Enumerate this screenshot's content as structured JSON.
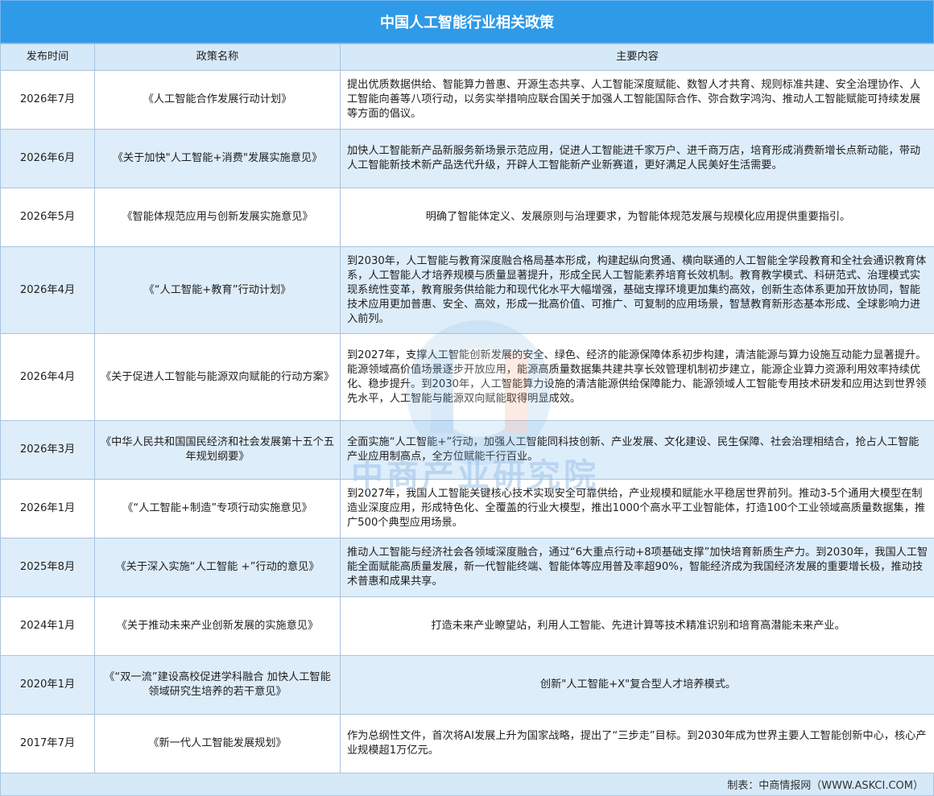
{
  "title": "中国人工智能行业相关政策",
  "headers": [
    "发布时间",
    "政策名称",
    "主要内容"
  ],
  "rows": [
    {
      "date": "2026年7月",
      "name": "《人工智能合作发展行动计划》",
      "content": "提出优质数据供给、智能算力普惠、开源生态共享、人工智能深度赋能、数智人才共育、规则标准共建、安全治理协作、人工智能向善等八项行动，以务实举措响应联合国关于加强人工智能国际合作、弥合数字鸿沟、推动人工智能赋能可持续发展等方面的倡议。"
    },
    {
      "date": "2026年6月",
      "name": "《关于加快\"人工智能+消费\"发展实施意见》",
      "content": "加快人工智能新产品新服务新场景示范应用，促进人工智能进千家万户、进千商万店，培育形成消费新增长点新动能，带动人工智能新技术新产品迭代升级，开辟人工智能新产业新赛道，更好满足人民美好生活需要。"
    },
    {
      "date": "2026年5月",
      "name": "《智能体规范应用与创新发展实施意见》",
      "content": "明确了智能体定义、发展原则与治理要求，为智能体规范发展与规模化应用提供重要指引。"
    },
    {
      "date": "2026年4月",
      "name": "《“人工智能+教育”行动计划》",
      "content": "到2030年，人工智能与教育深度融合格局基本形成，构建起纵向贯通、横向联通的人工智能全学段教育和全社会通识教育体系，人工智能人才培养规模与质量显著提升，形成全民人工智能素养培育长效机制。教育教学模式、科研范式、治理模式实现系统性变革，教育服务供给能力和现代化水平大幅增强，基础支撑环境更加集约高效，创新生态体系更加开放协同，智能技术应用更加普惠、安全、高效，形成一批高价值、可推广、可复制的应用场景，智慧教育新形态基本形成、全球影响力进入前列。"
    },
    {
      "date": "2026年4月",
      "name": "《关于促进人工智能与能源双向赋能的行动方案》",
      "content": "到2027年，支撑人工智能创新发展的安全、绿色、经济的能源保障体系初步构建，清洁能源与算力设施互动能力显著提升。能源领域高价值场景逐步开放应用，能源高质量数据集共建共享长效管理机制初步建立，能源企业算力资源利用效率持续优化、稳步提升。到2030年，人工智能算力设施的清洁能源供给保障能力、能源领域人工智能专用技术研发和应用达到世界领先水平，人工智能与能源双向赋能取得明显成效。"
    },
    {
      "date": "2026年3月",
      "name": "《中华人民共和国国民经济和社会发展第十五个五年规划纲要》",
      "content": "全面实施“人工智能+”行动，加强人工智能同科技创新、产业发展、文化建设、民生保障、社会治理相结合，抢占人工智能产业应用制高点，全方位赋能千行百业。"
    },
    {
      "date": "2026年1月",
      "name": "《“人工智能+制造”专项行动实施意见》",
      "content": "到2027年，我国人工智能关键核心技术实现安全可靠供给，产业规模和赋能水平稳居世界前列。推动3-5个通用大模型在制造业深度应用，形成特色化、全覆盖的行业大模型，推出1000个高水平工业智能体，打造100个工业领域高质量数据集，推广500个典型应用场景。"
    },
    {
      "date": "2025年8月",
      "name": "《关于深入实施“人工智能 +”行动的意见》",
      "content": "推动人工智能与经济社会各领域深度融合，通过“6大重点行动+8项基础支撑”加快培育新质生产力。到2030年，我国人工智能全面赋能高质量发展，新一代智能终端、智能体等应用普及率超90%，智能经济成为我国经济发展的重要增长极，推动技术普惠和成果共享。"
    },
    {
      "date": "2024年1月",
      "name": "《关于推动未来产业创新发展的实施意见》",
      "content": "打造未来产业瞭望站，利用人工智能、先进计算等技术精准识别和培育高潜能未来产业。"
    },
    {
      "date": "2020年1月",
      "name": "《“双一流”建设高校促进学科融合 加快人工智能领域研究生培养的若干意见》",
      "content": "创新\"人工智能+X\"复合型人才培养模式。"
    },
    {
      "date": "2017年7月",
      "name": "《新一代人工智能发展规划》",
      "content": "作为总纲性文件，首次将AI发展上升为国家战略，提出了“三步走”目标。到2030年成为世界主要人工智能创新中心，核心产业规模超1万亿元。"
    }
  ],
  "footer": "制表：中商情报网（WWW.ASKCI.COM）",
  "watermark": "中商产业研究院",
  "colors": {
    "title_bg": "#2f9ae8",
    "header_bg": "#d6e9f9",
    "alt_row_bg": "#deedfa",
    "border": "#a9c4dc"
  }
}
